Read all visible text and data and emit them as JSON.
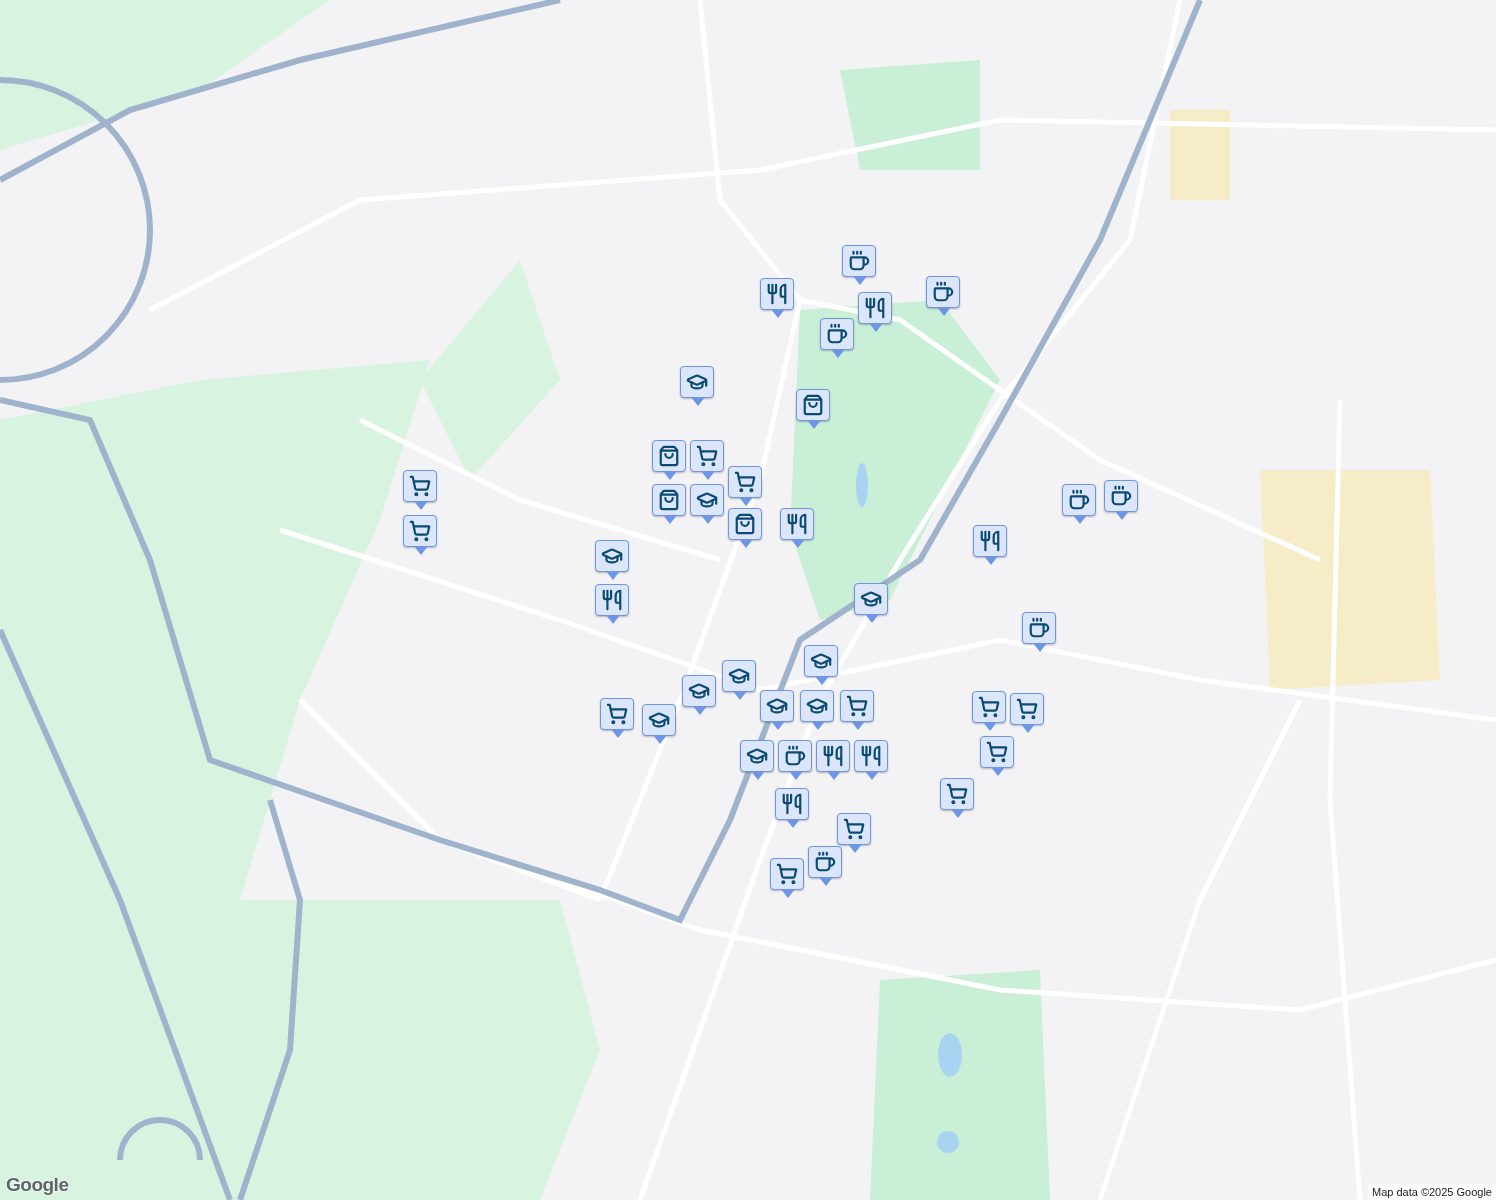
{
  "map": {
    "markers": [
      {
        "kind": "cafe"
      },
      {
        "kind": "restaurant"
      },
      {
        "kind": "restaurant"
      },
      {
        "kind": "cafe"
      },
      {
        "kind": "cafe"
      },
      {
        "kind": "school"
      },
      {
        "kind": "bag"
      },
      {
        "kind": "bag"
      },
      {
        "kind": "cart"
      },
      {
        "kind": "cart"
      },
      {
        "kind": "bag"
      },
      {
        "kind": "school"
      },
      {
        "kind": "bag"
      },
      {
        "kind": "restaurant"
      },
      {
        "kind": "cart"
      },
      {
        "kind": "cart"
      },
      {
        "kind": "school"
      },
      {
        "kind": "restaurant"
      },
      {
        "kind": "school"
      },
      {
        "kind": "school"
      },
      {
        "kind": "school"
      },
      {
        "kind": "school"
      },
      {
        "kind": "cart"
      },
      {
        "kind": "school"
      },
      {
        "kind": "school"
      },
      {
        "kind": "school"
      },
      {
        "kind": "cart"
      },
      {
        "kind": "restaurant"
      },
      {
        "kind": "school"
      },
      {
        "kind": "cafe"
      },
      {
        "kind": "restaurant"
      },
      {
        "kind": "restaurant"
      },
      {
        "kind": "cart"
      },
      {
        "kind": "cart"
      },
      {
        "kind": "cart"
      },
      {
        "kind": "cart"
      },
      {
        "kind": "cart"
      },
      {
        "kind": "restaurant"
      },
      {
        "kind": "cafe"
      },
      {
        "kind": "cafe"
      },
      {
        "kind": "cafe"
      },
      {
        "kind": "cafe"
      },
      {
        "kind": "cart"
      }
    ],
    "logo": "Google",
    "attribution": "Map data ©2025 Google"
  }
}
